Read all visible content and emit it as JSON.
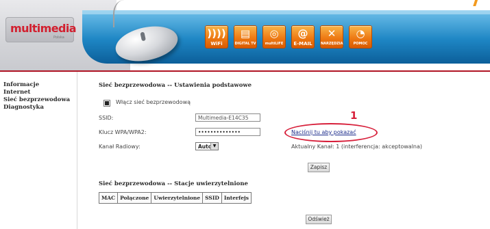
{
  "header": {
    "logo_text": "multimedia",
    "logo_sub": "Polska",
    "icons": [
      {
        "name": "wifi-icon",
        "glyph": "))))",
        "label": "WiFi",
        "big": true
      },
      {
        "name": "digital-tv-icon",
        "glyph": "▤",
        "label": "DIGITAL TV",
        "big": false
      },
      {
        "name": "multilife-icon",
        "glyph": "◎",
        "label": "multiLIFE",
        "big": false
      },
      {
        "name": "email-icon",
        "glyph": "@",
        "label": "E-MAIL",
        "big": true
      },
      {
        "name": "tools-icon",
        "glyph": "✕",
        "label": "NARZĘDZIA",
        "big": false
      },
      {
        "name": "support-icon",
        "glyph": "◔",
        "label": "POMOC",
        "big": false
      }
    ]
  },
  "sidebar": {
    "items": [
      {
        "label": "Informacje"
      },
      {
        "label": "Internet"
      },
      {
        "label": "Sieć bezprzewodowa"
      },
      {
        "label": "Diagnostyka"
      }
    ]
  },
  "basic": {
    "title": "Sieć bezprzewodowa -- Ustawienia podstawowe",
    "enable_label": "Włącz sieć bezprzewodową",
    "ssid_label": "SSID:",
    "ssid_value": "Multimedia-E14C35",
    "key_label": "Klucz WPA/WPA2:",
    "key_value": "••••••••••••••",
    "show_link": "Naciśnij tu aby pokazać",
    "channel_label": "Kanał Radiowy:",
    "channel_value": "Auto",
    "current_channel": "Aktualny Kanał: 1 (interferencja: akceptowalna)",
    "save_button": "Zapisz"
  },
  "annotation": {
    "number": "1",
    "color": "#d71f3a"
  },
  "stations": {
    "title": "Sieć bezprzewodowa -- Stacje uwierzytelnione",
    "columns": [
      "MAC",
      "Połączone",
      "Uwierzytelnione",
      "SSID",
      "Interfejs"
    ],
    "refresh_button": "Odśwież"
  },
  "colors": {
    "accent_red": "#b01424",
    "header_blue": "#1e86c4",
    "icon_orange": "#ee7a14"
  }
}
